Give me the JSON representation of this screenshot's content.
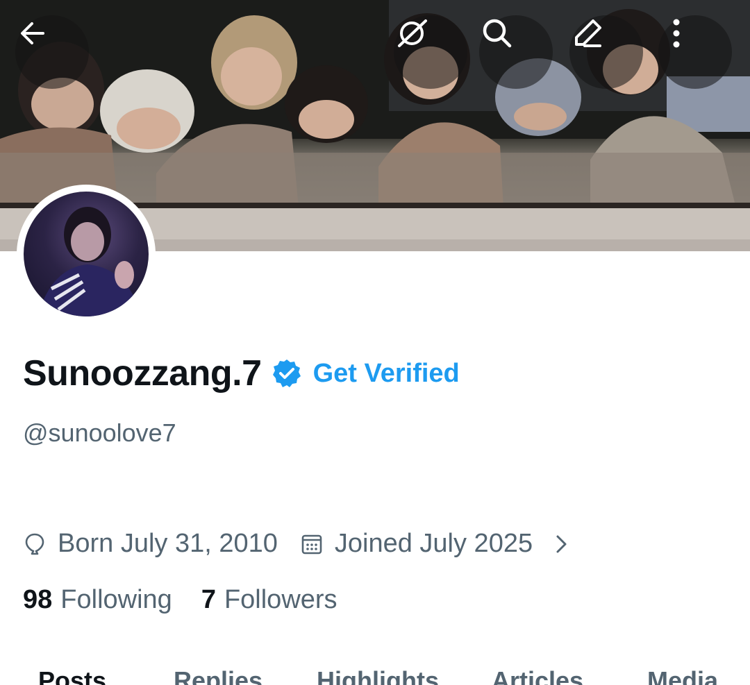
{
  "header": {
    "back_icon": "back-arrow-icon",
    "grok_icon": "grok-icon",
    "search_icon": "search-icon",
    "edit_icon": "edit-pencil-icon",
    "more_icon": "more-vertical-icon"
  },
  "profile": {
    "display_name": "Sunoozzang.7",
    "verified_icon": "verified-badge-icon",
    "verified_color": "#1d9bf0",
    "get_verified_label": "Get Verified",
    "handle": "@sunoolove7",
    "birth": "Born July 31, 2010",
    "joined": "Joined July 2025",
    "following_count": "98",
    "following_label": "Following",
    "followers_count": "7",
    "followers_label": "Followers"
  },
  "tabs": [
    {
      "label": "Posts",
      "active": true
    },
    {
      "label": "Replies",
      "active": false
    },
    {
      "label": "Highlights",
      "active": false
    },
    {
      "label": "Articles",
      "active": false
    },
    {
      "label": "Media",
      "active": false
    }
  ],
  "colors": {
    "text_primary": "#0f1419",
    "text_secondary": "#536471",
    "accent": "#1d9bf0"
  }
}
